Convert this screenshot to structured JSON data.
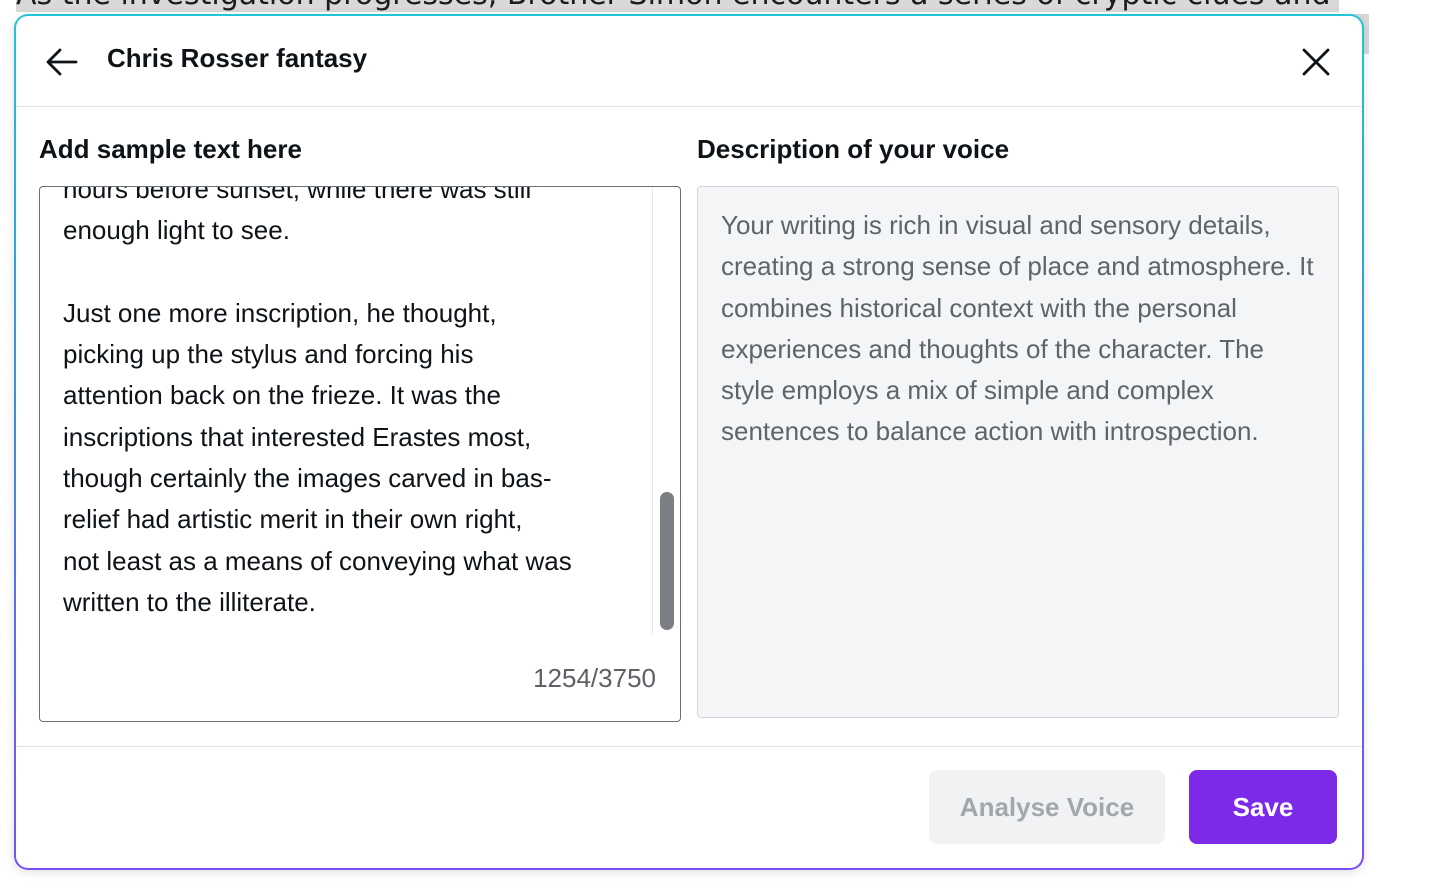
{
  "background": {
    "partial_text": "As the investigation progresses, Brother Simon encounters a series of cryptic clues and"
  },
  "header": {
    "title": "Chris Rosser fantasy"
  },
  "sample": {
    "label": "Add sample text here",
    "text": "hours before sunset, while there was still\nenough light to see.\n\nJust one more inscription, he thought,\npicking up the stylus and forcing his\nattention back on the frieze. It was the\ninscriptions that interested Erastes most,\nthough certainly the images carved in bas-\nrelief had artistic merit in their own right,\nnot least as a means of conveying what was\nwritten to the illiterate.",
    "char_count": "1254/3750",
    "scroll_position_fraction": 0.9
  },
  "description": {
    "label": "Description of your voice",
    "text": "Your writing is rich in visual and sensory details, creating a strong sense of place and atmosphere. It combines historical context with the personal experiences and thoughts of the character. The style employs a mix of simple and complex sentences to balance action with introspection."
  },
  "footer": {
    "analyse_label": "Analyse Voice",
    "save_label": "Save"
  },
  "colors": {
    "primary_button": "#7d2ae8",
    "disabled_button_bg": "#f1f2f4",
    "disabled_button_text": "#a3a7ad",
    "description_bg": "#f4f5f7",
    "modal_border_gradient": [
      "#22c4d6",
      "#3b8fe0",
      "#7a4ef5"
    ]
  },
  "icons": {
    "back": "arrow-left-icon",
    "close": "close-icon"
  }
}
